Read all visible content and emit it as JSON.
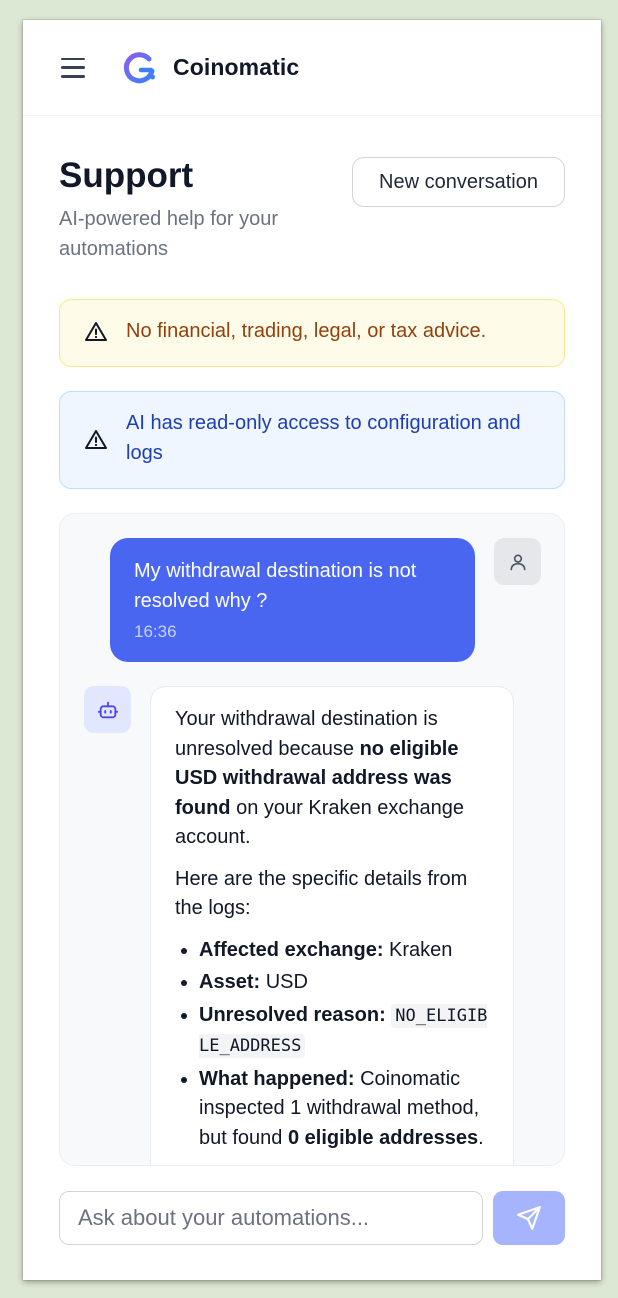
{
  "app": {
    "brand": "Coinomatic"
  },
  "page": {
    "title": "Support",
    "subtitle": "AI-powered help for your automations",
    "new_conversation_label": "New conversation"
  },
  "alerts": [
    {
      "text": "No financial, trading, legal, or tax advice.",
      "tone": "#92400e"
    },
    {
      "text": "AI has read-only access to configuration and logs",
      "tone": "#1e40af"
    }
  ],
  "chat": {
    "user_message": {
      "text": "My withdrawal destination is not resolved why ?",
      "time": "16:36"
    },
    "bot_message": {
      "intro_1": "Your withdrawal destination is unresolved because ",
      "intro_bold": "no eligible USD withdrawal address was found",
      "intro_2": " on your Kraken exchange account.",
      "details_lead": "Here are the specific details from the logs:",
      "items": [
        {
          "label": "Affected exchange:",
          "value": " Kraken"
        },
        {
          "label": "Asset:",
          "value": " USD"
        },
        {
          "label": "Unresolved reason:",
          "code": "NO_ELIGIBLE_ADDRESS"
        },
        {
          "label": "What happened:",
          "value": " Coinomatic inspected 1 withdrawal method, but found ",
          "bold_tail": "0 eligible addresses",
          "tail": "."
        }
      ]
    }
  },
  "composer": {
    "placeholder": "Ask about your automations..."
  },
  "colors": {
    "accent": "#4866f0",
    "send_disabled": "#a5b4fc"
  },
  "icons": [
    "menu-icon",
    "coinomatic-logo",
    "warning-icon",
    "user-icon",
    "bot-icon",
    "send-icon"
  ]
}
